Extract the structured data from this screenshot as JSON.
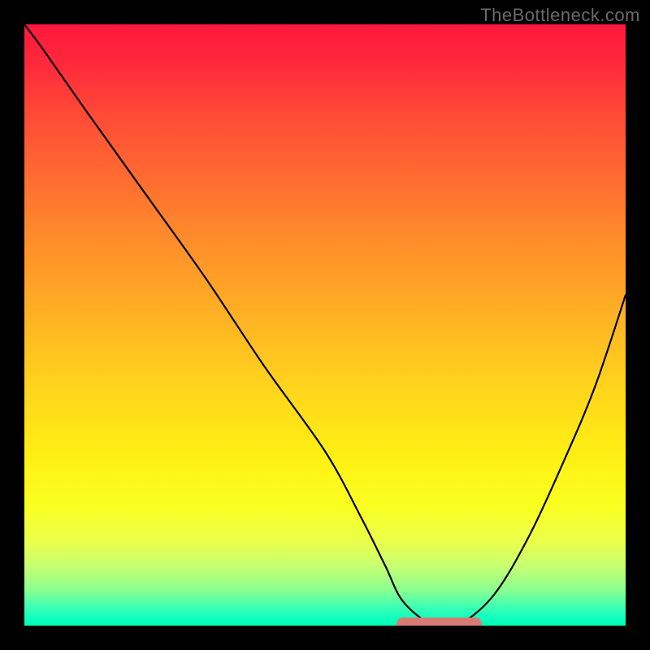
{
  "watermark": "TheBottleneck.com",
  "colors": {
    "frame": "#000000",
    "curve": "#000000",
    "marker": "#d87b74",
    "watermark_text": "#6a6a6a",
    "gradient_top": "#ff183e",
    "gradient_bottom": "#02ffae"
  },
  "chart_data": {
    "type": "line",
    "title": "",
    "xlabel": "",
    "ylabel": "",
    "xlim": [
      0,
      100
    ],
    "ylim": [
      0,
      100
    ],
    "grid": false,
    "legend": false,
    "x": [
      0,
      3,
      10,
      20,
      30,
      40,
      50,
      56,
      60,
      63,
      68,
      72,
      78,
      84,
      90,
      95,
      100
    ],
    "values": [
      100,
      96,
      86,
      72,
      58,
      43,
      29,
      18,
      10,
      4,
      0,
      0,
      5,
      15,
      28,
      40,
      55
    ],
    "flat_region_x": [
      63,
      75
    ],
    "annotations": []
  }
}
